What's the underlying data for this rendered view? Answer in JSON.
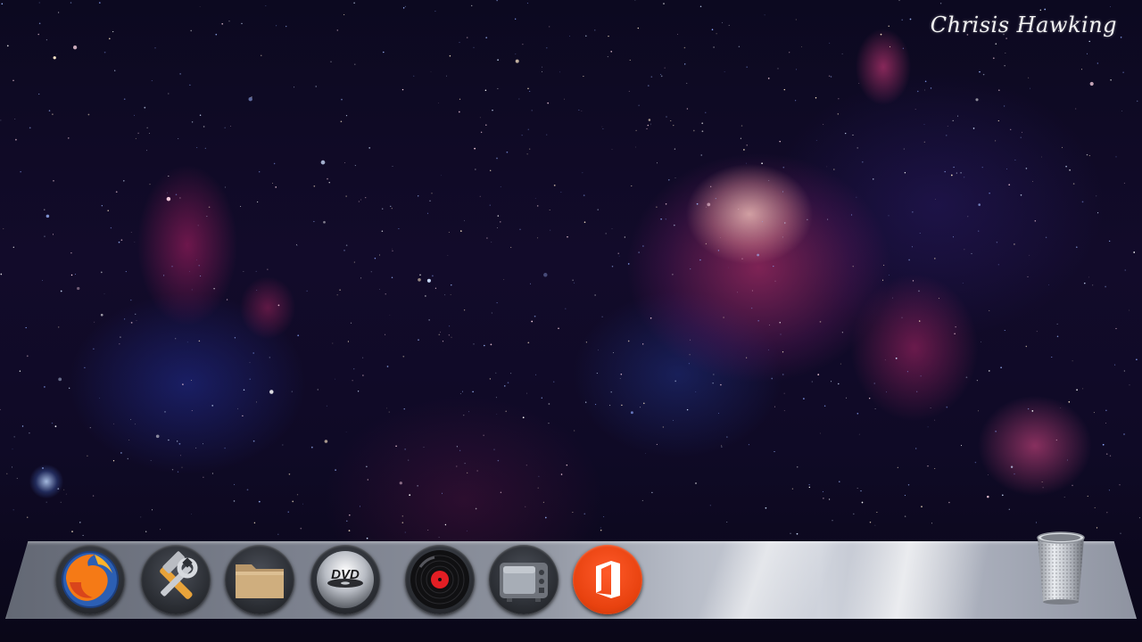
{
  "desktop": {
    "signature_text": "Chrisis Hawking"
  },
  "dock": {
    "items": [
      {
        "name": "firefox-icon"
      },
      {
        "name": "tools-icon"
      },
      {
        "name": "folder-icon"
      },
      {
        "name": "dvd-icon"
      },
      {
        "name": "music-record-icon"
      },
      {
        "name": "tv-icon"
      },
      {
        "name": "office-icon"
      }
    ],
    "dvd_label": "DVD",
    "trash_icon": "trash-icon"
  },
  "colors": {
    "office_brand": "#e8420f",
    "firefox_orange": "#f57a16",
    "firefox_blue": "#2c5fb3",
    "folder_tan": "#cfae7e",
    "record_red": "#e21e24"
  }
}
